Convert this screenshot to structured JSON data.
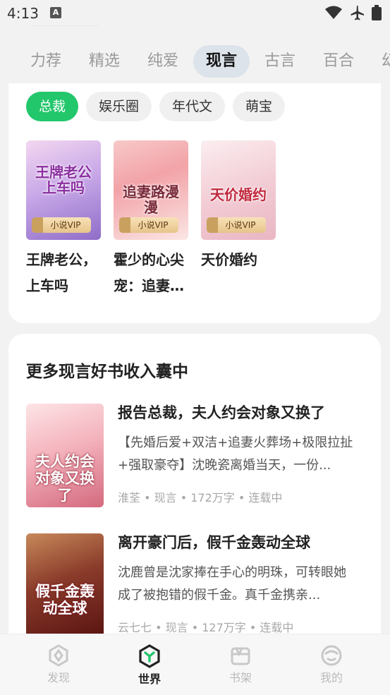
{
  "status_bar": {
    "time": "4:13",
    "icons": [
      "a-icon",
      "wifi-icon",
      "airplane-icon",
      "battery-icon"
    ]
  },
  "tabs": [
    {
      "label": "力荐"
    },
    {
      "label": "精选"
    },
    {
      "label": "纯爱"
    },
    {
      "label": "现言",
      "active": true
    },
    {
      "label": "古言"
    },
    {
      "label": "百合"
    },
    {
      "label": "幻"
    }
  ],
  "chips": [
    {
      "label": "总裁",
      "active": true
    },
    {
      "label": "娱乐圈"
    },
    {
      "label": "年代文"
    },
    {
      "label": "萌宝"
    }
  ],
  "featured_books": [
    {
      "title": "王牌老公，上车吗",
      "cover_text": "王牌老公上车吗",
      "vip": "小说VIP"
    },
    {
      "title": "霍少的心尖宠：追妻路漫漫",
      "cover_text": "追妻路漫漫",
      "vip": "小说VIP"
    },
    {
      "title": "天价婚约",
      "cover_text": "天价婚约",
      "vip": "小说VIP"
    }
  ],
  "section": {
    "title": "更多现言好书收入囊中",
    "books": [
      {
        "title": "报告总裁，夫人约会对象又换了",
        "desc": "【先婚后爱+双洁+追妻火葬场+极限拉扯+强取豪夺】沈晚瓷离婚当天，一份...",
        "meta": "淮荃 • 现言 • 172万字 • 连载中",
        "cover_text": "夫人约会对象又换了"
      },
      {
        "title": "离开豪门后，假千金轰动全球",
        "desc": "沈鹿曾是沈家捧在手心的明珠，可转眼她成了被抱错的假千金。真千金携亲...",
        "meta": "云七七 • 现言 • 127万字 • 连载中",
        "cover_text": "假千金轰动全球"
      }
    ]
  },
  "bottom_nav": [
    {
      "label": "发现",
      "icon": "discover-icon"
    },
    {
      "label": "世界",
      "icon": "world-icon",
      "active": true
    },
    {
      "label": "书架",
      "icon": "bookshelf-icon"
    },
    {
      "label": "我的",
      "icon": "profile-icon"
    }
  ],
  "colors": {
    "accent": "#22c66b",
    "active_tab_bg": "#dde3ea",
    "background": "#f2f2f2"
  }
}
